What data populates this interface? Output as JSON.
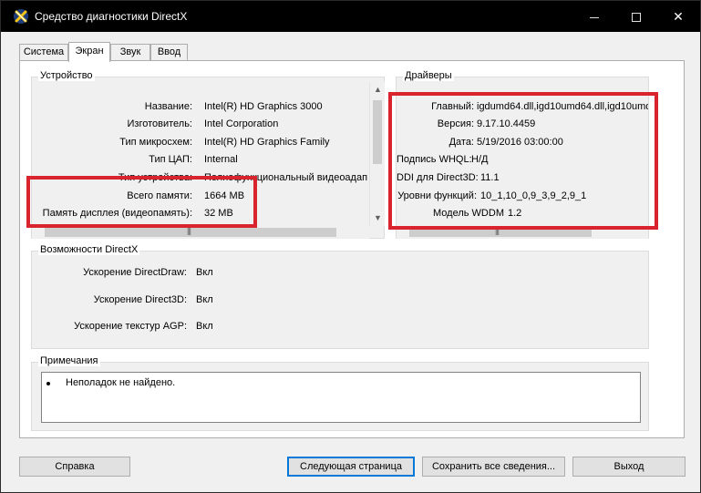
{
  "window": {
    "title": "Средство диагностики DirectX"
  },
  "tabs": [
    {
      "label": "Система"
    },
    {
      "label": "Экран",
      "active": true
    },
    {
      "label": "Звук"
    },
    {
      "label": "Ввод"
    }
  ],
  "device": {
    "group_label": "Устройство",
    "rows": [
      {
        "label": "Название:",
        "value": "Intel(R) HD Graphics 3000"
      },
      {
        "label": "Изготовитель:",
        "value": "Intel Corporation"
      },
      {
        "label": "Тип микросхем:",
        "value": "Intel(R) HD Graphics Family"
      },
      {
        "label": "Тип ЦАП:",
        "value": "Internal"
      },
      {
        "label": "Тип устройства:",
        "value": "Полнофункциональный видеоадап"
      },
      {
        "label": "Всего памяти:",
        "value": "1664 MB"
      },
      {
        "label": "Память дисплея (видеопамять):",
        "value": "32 MB"
      }
    ]
  },
  "drivers": {
    "group_label": "Драйверы",
    "rows": [
      {
        "label": "Главный:",
        "value": "igdumd64.dll,igd10umd64.dll,igd10umd"
      },
      {
        "label": "Версия:",
        "value": "9.17.10.4459"
      },
      {
        "label": "Дата:",
        "value": "5/19/2016 03:00:00"
      },
      {
        "label": "Подпись WHQL:",
        "value": "Н/Д"
      },
      {
        "label": "DDI для Direct3D:",
        "value": "11.1"
      },
      {
        "label": "Уровни функций:",
        "value": "10_1,10_0,9_3,9_2,9_1"
      },
      {
        "label": "Модель WDDM",
        "value": "1.2"
      }
    ]
  },
  "directx": {
    "group_label": "Возможности DirectX",
    "rows": [
      {
        "label": "Ускорение DirectDraw:",
        "value": "Вкл"
      },
      {
        "label": "Ускорение Direct3D:",
        "value": "Вкл"
      },
      {
        "label": "Ускорение текстур AGP:",
        "value": "Вкл"
      }
    ]
  },
  "notes": {
    "group_label": "Примечания",
    "items": [
      "Неполадок не найдено."
    ]
  },
  "buttons": {
    "help": "Справка",
    "next_page": "Следующая страница",
    "save_all": "Сохранить все сведения...",
    "exit": "Выход"
  },
  "colors": {
    "highlight_box": "#d9232d",
    "title_bar": "#000000",
    "window_bg": "#f0f0f0"
  }
}
